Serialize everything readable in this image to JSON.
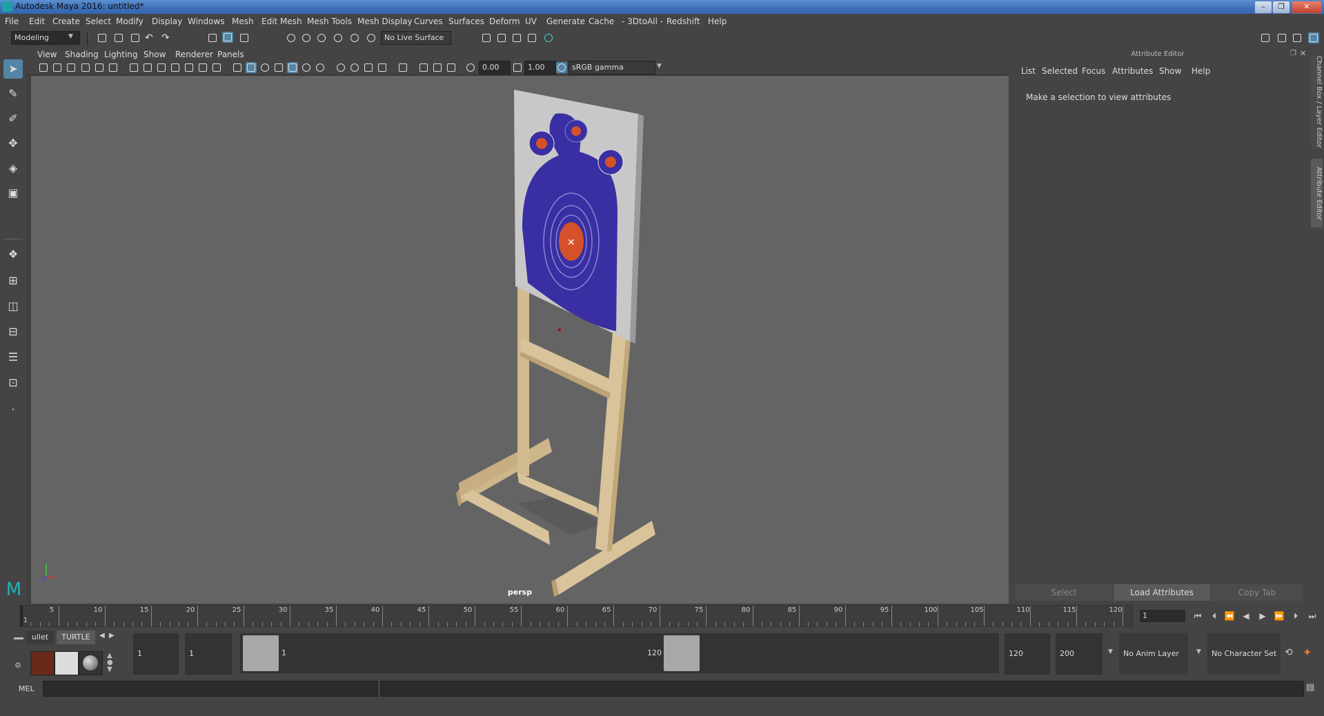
{
  "window": {
    "title": "Autodesk Maya 2016: untitled*"
  },
  "menubar": [
    "File",
    "Edit",
    "Create",
    "Select",
    "Modify",
    "Display",
    "Windows",
    "Mesh",
    "Edit Mesh",
    "Mesh Tools",
    "Mesh Display",
    "Curves",
    "Surfaces",
    "Deform",
    "UV",
    "Generate",
    "Cache",
    "- 3DtoAll -",
    "Redshift",
    "Help"
  ],
  "statusline": {
    "mode": "Modeling",
    "live_surface": "No Live Surface"
  },
  "panel": {
    "menus": [
      "View",
      "Shading",
      "Lighting",
      "Show",
      "Renderer",
      "Panels"
    ],
    "exposure": "0.00",
    "gamma": "1.00",
    "color_space": "sRGB gamma",
    "camera_label": "persp"
  },
  "attribute_editor": {
    "header": "Attribute Editor",
    "menus": [
      "List",
      "Selected",
      "Focus",
      "Attributes",
      "Show",
      "Help"
    ],
    "message": "Make a selection to view attributes",
    "buttons": {
      "select": "Select",
      "load": "Load Attributes",
      "copy_tab": "Copy Tab"
    },
    "side_tabs": {
      "channel_box": "Channel Box / Layer Editor",
      "attribute_editor": "Attribute Editor"
    }
  },
  "timeslider": {
    "ticks": [
      "1",
      "5",
      "10",
      "15",
      "20",
      "25",
      "30",
      "35",
      "40",
      "45",
      "50",
      "55",
      "60",
      "65",
      "70",
      "75",
      "80",
      "85",
      "90",
      "95",
      "100",
      "105",
      "110",
      "115",
      "120"
    ],
    "current_frame": "1"
  },
  "range": {
    "start": "1",
    "anim_start": "1",
    "range_start_label": "1",
    "range_end_label": "120",
    "end": "120",
    "anim_end": "200",
    "anim_layer": "No Anim Layer",
    "character_set": "No Character Set"
  },
  "shelf": {
    "tabs": [
      "ullet",
      "TURTLE"
    ]
  },
  "commandline": {
    "label": "MEL"
  },
  "colors": {
    "viewport_bg": "#646464",
    "selection_accent": "#5285a6",
    "target_blue": "#3a2ea3",
    "target_orange": "#d4512a",
    "wood": "#d9c39a"
  }
}
